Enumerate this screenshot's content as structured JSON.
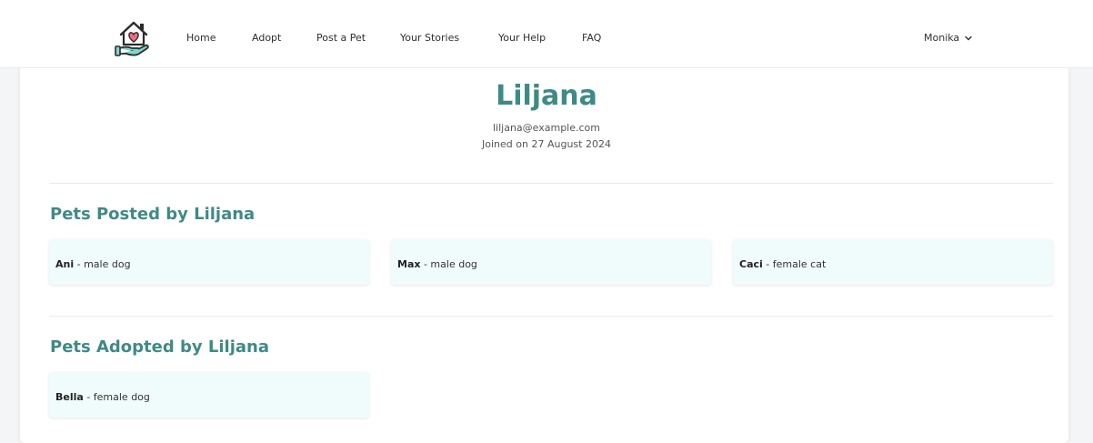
{
  "nav": {
    "links": [
      "Home",
      "Adopt",
      "Post a Pet",
      "Your Stories",
      "Your Help",
      "FAQ"
    ],
    "user": "Monika"
  },
  "profile": {
    "name": "Liljana",
    "email": "liljana@example.com",
    "joined": "Joined on 27 August 2024"
  },
  "posted": {
    "title": "Pets Posted by Liljana",
    "pets": [
      {
        "name": "Ani",
        "desc": "- male dog"
      },
      {
        "name": "Max",
        "desc": "- male dog"
      },
      {
        "name": "Caci",
        "desc": "- female cat"
      }
    ]
  },
  "adopted": {
    "title": "Pets Adopted by Liljana",
    "pets": [
      {
        "name": "Bella",
        "desc": "- female dog"
      }
    ]
  },
  "colors": {
    "accent": "#3e8a86",
    "pet_card_bg": "#f0fcfb",
    "logo_outline": "#2b2b2b",
    "logo_heart": "#f26b82",
    "logo_hand": "#7fd6cf"
  },
  "icons": {
    "logo": "house-heart-hand-icon",
    "user_menu": "chevron-down-icon"
  }
}
